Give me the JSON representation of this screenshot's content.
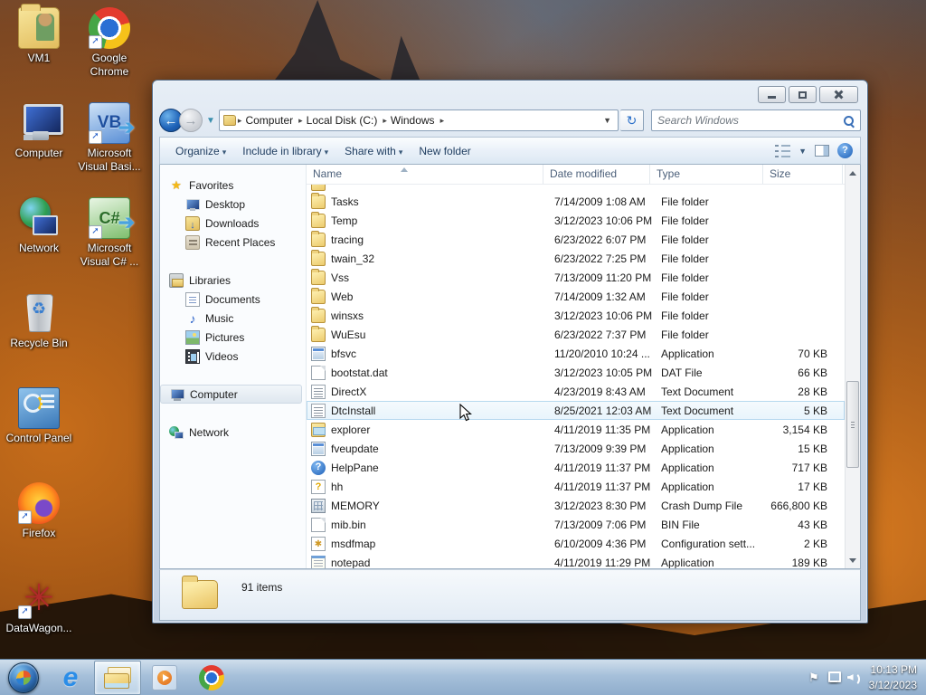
{
  "colors": {
    "taskbar": "#a6c0da",
    "window_chrome": "#ccd9e8",
    "selection_border": "#b8d9ef",
    "selection_fill": "#e8f4fc",
    "folder_icon": "#eccb6d",
    "accent_blue": "#1e62b8"
  },
  "desktop": {
    "icons": [
      {
        "label": "VM1",
        "icon": "dt-vm1",
        "shortcut": false
      },
      {
        "label": "Google\nChrome",
        "icon": "dt-chrome",
        "shortcut": true
      },
      {
        "label": "Computer",
        "icon": "dt-computer",
        "shortcut": false
      },
      {
        "label": "Microsoft\nVisual Basi...",
        "icon": "dt-vb",
        "shortcut": true
      },
      {
        "label": "Network",
        "icon": "dt-network",
        "shortcut": false
      },
      {
        "label": "Microsoft\nVisual C# ...",
        "icon": "dt-cs",
        "shortcut": true
      },
      {
        "label": "Recycle Bin",
        "icon": "dt-recycle",
        "shortcut": false
      },
      {
        "label": "Control Panel",
        "icon": "dt-control",
        "shortcut": false
      },
      {
        "label": "Firefox",
        "icon": "dt-firefox",
        "shortcut": true
      },
      {
        "label": "DataWagon...",
        "icon": "dt-dw",
        "shortcut": true
      }
    ]
  },
  "window": {
    "breadcrumb": {
      "segments": [
        "Computer",
        "Local Disk (C:)",
        "Windows"
      ],
      "arrow": "▸"
    },
    "search": {
      "placeholder": "Search Windows"
    },
    "toolbar": {
      "items": [
        {
          "label": "Organize",
          "dropdown": "▾"
        },
        {
          "label": "Include in library",
          "dropdown": "▾"
        },
        {
          "label": "Share with",
          "dropdown": "▾"
        },
        {
          "label": "New folder",
          "dropdown": ""
        }
      ]
    },
    "sidebar": {
      "rows": [
        {
          "label": "Favorites",
          "icon": "sb-star",
          "level": 0,
          "gap": false,
          "selected": false
        },
        {
          "label": "Desktop",
          "icon": "sb-desktop",
          "level": 1,
          "gap": false,
          "selected": false
        },
        {
          "label": "Downloads",
          "icon": "sb-down",
          "level": 1,
          "gap": false,
          "selected": false
        },
        {
          "label": "Recent Places",
          "icon": "sb-recent",
          "level": 1,
          "gap": false,
          "selected": false
        },
        {
          "label": "Libraries",
          "icon": "sb-lib",
          "level": 0,
          "gap": true,
          "selected": false
        },
        {
          "label": "Documents",
          "icon": "sb-doc",
          "level": 1,
          "gap": false,
          "selected": false
        },
        {
          "label": "Music",
          "icon": "sb-music",
          "level": 1,
          "gap": false,
          "selected": false
        },
        {
          "label": "Pictures",
          "icon": "sb-pic",
          "level": 1,
          "gap": false,
          "selected": false
        },
        {
          "label": "Videos",
          "icon": "sb-video",
          "level": 1,
          "gap": false,
          "selected": false
        },
        {
          "label": "Computer",
          "icon": "sb-computer",
          "level": 0,
          "gap": true,
          "selected": true
        },
        {
          "label": "Network",
          "icon": "sb-network",
          "level": 0,
          "gap": true,
          "selected": false
        }
      ]
    },
    "files": {
      "columns": [
        {
          "label": "Name"
        },
        {
          "label": "Date modified"
        },
        {
          "label": "Type"
        },
        {
          "label": "Size"
        }
      ],
      "rows": [
        {
          "name": "",
          "date": "",
          "type": "",
          "size": "",
          "icon": "fi-folder",
          "state": "clip-top"
        },
        {
          "name": "Tasks",
          "date": "7/14/2009 1:08 AM",
          "type": "File folder",
          "size": "",
          "icon": "fi-folder",
          "state": ""
        },
        {
          "name": "Temp",
          "date": "3/12/2023 10:06 PM",
          "type": "File folder",
          "size": "",
          "icon": "fi-folder",
          "state": ""
        },
        {
          "name": "tracing",
          "date": "6/23/2022 6:07 PM",
          "type": "File folder",
          "size": "",
          "icon": "fi-folder",
          "state": ""
        },
        {
          "name": "twain_32",
          "date": "6/23/2022 7:25 PM",
          "type": "File folder",
          "size": "",
          "icon": "fi-folder",
          "state": ""
        },
        {
          "name": "Vss",
          "date": "7/13/2009 11:20 PM",
          "type": "File folder",
          "size": "",
          "icon": "fi-folder",
          "state": ""
        },
        {
          "name": "Web",
          "date": "7/14/2009 1:32 AM",
          "type": "File folder",
          "size": "",
          "icon": "fi-folder",
          "state": ""
        },
        {
          "name": "winsxs",
          "date": "3/12/2023 10:06 PM",
          "type": "File folder",
          "size": "",
          "icon": "fi-folder",
          "state": ""
        },
        {
          "name": "WuEsu",
          "date": "6/23/2022 7:37 PM",
          "type": "File folder",
          "size": "",
          "icon": "fi-folder",
          "state": ""
        },
        {
          "name": "bfsvc",
          "date": "11/20/2010 10:24 ...",
          "type": "Application",
          "size": "70 KB",
          "icon": "fi-app",
          "state": ""
        },
        {
          "name": "bootstat.dat",
          "date": "3/12/2023 10:05 PM",
          "type": "DAT File",
          "size": "66 KB",
          "icon": "fi-blank",
          "state": ""
        },
        {
          "name": "DirectX",
          "date": "4/23/2019 8:43 AM",
          "type": "Text Document",
          "size": "28 KB",
          "icon": "fi-txt",
          "state": ""
        },
        {
          "name": "DtcInstall",
          "date": "8/25/2021 12:03 AM",
          "type": "Text Document",
          "size": "5 KB",
          "icon": "fi-txt",
          "state": "hover"
        },
        {
          "name": "explorer",
          "date": "4/11/2019 11:35 PM",
          "type": "Application",
          "size": "3,154 KB",
          "icon": "fi-explorer",
          "state": ""
        },
        {
          "name": "fveupdate",
          "date": "7/13/2009 9:39 PM",
          "type": "Application",
          "size": "15 KB",
          "icon": "fi-app",
          "state": ""
        },
        {
          "name": "HelpPane",
          "date": "4/11/2019 11:37 PM",
          "type": "Application",
          "size": "717 KB",
          "icon": "fi-help",
          "state": ""
        },
        {
          "name": "hh",
          "date": "4/11/2019 11:37 PM",
          "type": "Application",
          "size": "17 KB",
          "icon": "fi-hh",
          "state": ""
        },
        {
          "name": "MEMORY",
          "date": "3/12/2023 8:30 PM",
          "type": "Crash Dump File",
          "size": "666,800 KB",
          "icon": "fi-mem",
          "state": ""
        },
        {
          "name": "mib.bin",
          "date": "7/13/2009 7:06 PM",
          "type": "BIN File",
          "size": "43 KB",
          "icon": "fi-blank",
          "state": ""
        },
        {
          "name": "msdfmap",
          "date": "6/10/2009 4:36 PM",
          "type": "Configuration sett...",
          "size": "2 KB",
          "icon": "fi-config",
          "state": ""
        },
        {
          "name": "notepad",
          "date": "4/11/2019 11:29 PM",
          "type": "Application",
          "size": "189 KB",
          "icon": "fi-notepad",
          "state": ""
        }
      ]
    },
    "status": {
      "count_label": "91 items"
    }
  },
  "taskbar": {
    "buttons": [
      {
        "icon": "tb-start",
        "active": false,
        "name": "start-button"
      },
      {
        "icon": "tb-ie",
        "active": false,
        "name": "internet-explorer",
        "glyph": "e"
      },
      {
        "icon": "tb-explorer",
        "active": true,
        "name": "windows-explorer"
      },
      {
        "icon": "tb-wmp",
        "active": false,
        "name": "media-player"
      },
      {
        "icon": "tb-chrome",
        "active": false,
        "name": "chrome"
      }
    ],
    "tray": {
      "time": "10:13 PM",
      "date": "3/12/2023",
      "flag": "⚑"
    }
  }
}
